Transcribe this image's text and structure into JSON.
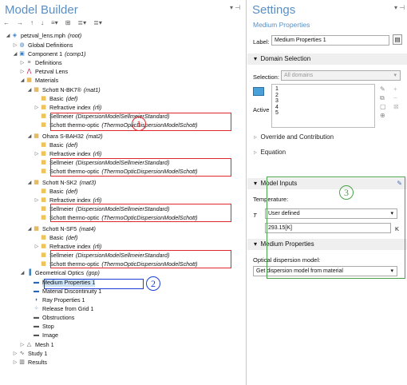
{
  "model_builder": {
    "title": "Model Builder",
    "toolbar_icons": [
      "back-arrow-icon",
      "forward-arrow-icon",
      "up-arrow-icon",
      "down-arrow-icon",
      "filter-icon",
      "tree-options-icon",
      "expand-icon",
      "collapse-icon"
    ],
    "tree": [
      {
        "label": "petzval_lens.mph",
        "tag": "(root)",
        "icon": "file-icon",
        "indent": 0,
        "expanded": true
      },
      {
        "label": "Global Definitions",
        "tag": "",
        "icon": "globe-icon",
        "indent": 1,
        "expanded": false
      },
      {
        "label": "Component 1",
        "tag": "(comp1)",
        "icon": "component-icon",
        "indent": 1,
        "expanded": true
      },
      {
        "label": "Definitions",
        "tag": "",
        "icon": "definitions-icon",
        "indent": 2,
        "expanded": false
      },
      {
        "label": "Petzval Lens",
        "tag": "",
        "icon": "geometry-icon",
        "indent": 2,
        "expanded": false
      },
      {
        "label": "Materials",
        "tag": "",
        "icon": "materials-icon",
        "indent": 2,
        "expanded": true
      },
      {
        "label": "Schott N-BK7®",
        "tag": "(mat1)",
        "icon": "material-icon",
        "indent": 3,
        "expanded": true
      },
      {
        "label": "Basic",
        "tag": "(def)",
        "icon": "property-icon",
        "indent": 4
      },
      {
        "label": "Refractive index",
        "tag": "(rfi)",
        "icon": "property-icon",
        "indent": 4,
        "expanded": false
      },
      {
        "label": "Sellmeier",
        "tag": "(DispersionModelSellmeierStandard)",
        "icon": "property-icon",
        "indent": 4
      },
      {
        "label": "Schott thermo-optic",
        "tag": "(ThermoOpticDispersionModelSchott)",
        "icon": "property-icon",
        "indent": 4
      },
      {
        "label": "Ohara S-BAH32",
        "tag": "(mat2)",
        "icon": "material-icon",
        "indent": 3,
        "expanded": true
      },
      {
        "label": "Basic",
        "tag": "(def)",
        "icon": "property-icon",
        "indent": 4
      },
      {
        "label": "Refractive index",
        "tag": "(rfi)",
        "icon": "property-icon",
        "indent": 4,
        "expanded": false
      },
      {
        "label": "Sellmeier",
        "tag": "(DispersionModelSellmeierStandard)",
        "icon": "property-icon",
        "indent": 4
      },
      {
        "label": "Schott thermo-optic",
        "tag": "(ThermoOpticDispersionModelSchott)",
        "icon": "property-icon",
        "indent": 4
      },
      {
        "label": "Schott N-SK2",
        "tag": "(mat3)",
        "icon": "material-icon",
        "indent": 3,
        "expanded": true
      },
      {
        "label": "Basic",
        "tag": "(def)",
        "icon": "property-icon",
        "indent": 4
      },
      {
        "label": "Refractive index",
        "tag": "(rfi)",
        "icon": "property-icon",
        "indent": 4,
        "expanded": false
      },
      {
        "label": "Sellmeier",
        "tag": "(DispersionModelSellmeierStandard)",
        "icon": "property-icon",
        "indent": 4
      },
      {
        "label": "Schott thermo-optic",
        "tag": "(ThermoOpticDispersionModelSchott)",
        "icon": "property-icon",
        "indent": 4
      },
      {
        "label": "Schott N-SF5",
        "tag": "(mat4)",
        "icon": "material-icon",
        "indent": 3,
        "expanded": true
      },
      {
        "label": "Basic",
        "tag": "(def)",
        "icon": "property-icon",
        "indent": 4
      },
      {
        "label": "Refractive index",
        "tag": "(rfi)",
        "icon": "property-icon",
        "indent": 4,
        "expanded": false
      },
      {
        "label": "Sellmeier",
        "tag": "(DispersionModelSellmeierStandard)",
        "icon": "property-icon",
        "indent": 4
      },
      {
        "label": "Schott thermo-optic",
        "tag": "(ThermoOpticDispersionModelSchott)",
        "icon": "property-icon",
        "indent": 4
      },
      {
        "label": "Geometrical Optics",
        "tag": "(gop)",
        "icon": "physics-icon",
        "indent": 2,
        "expanded": true
      },
      {
        "label": "Medium Properties 1",
        "tag": "",
        "icon": "medium-icon",
        "indent": 3,
        "selected": true
      },
      {
        "label": "Material Discontinuity 1",
        "tag": "",
        "icon": "medium-icon",
        "indent": 3
      },
      {
        "label": "Ray Properties 1",
        "tag": "",
        "icon": "ray-icon",
        "indent": 3
      },
      {
        "label": "Release from Grid 1",
        "tag": "",
        "icon": "grid-icon",
        "indent": 3
      },
      {
        "label": "Obstructions",
        "tag": "",
        "icon": "wall-icon",
        "indent": 3
      },
      {
        "label": "Stop",
        "tag": "",
        "icon": "wall-icon",
        "indent": 3
      },
      {
        "label": "Image",
        "tag": "",
        "icon": "wall-icon",
        "indent": 3
      },
      {
        "label": "Mesh 1",
        "tag": "",
        "icon": "mesh-icon",
        "indent": 2,
        "expanded": false
      },
      {
        "label": "Study 1",
        "tag": "",
        "icon": "study-icon",
        "indent": 1,
        "expanded": false
      },
      {
        "label": "Results",
        "tag": "",
        "icon": "results-icon",
        "indent": 1,
        "expanded": false
      }
    ],
    "callouts": [
      "1",
      "2",
      "3"
    ]
  },
  "settings": {
    "title": "Settings",
    "subtitle": "Medium Properties",
    "label_caption": "Label:",
    "label_value": "Medium Properties 1",
    "sections": {
      "domain_selection": "Domain Selection",
      "override": "Override and Contribution",
      "equation": "Equation",
      "model_inputs": "Model Inputs",
      "medium_properties": "Medium Properties"
    },
    "selection_caption": "Selection:",
    "selection_value": "All domains",
    "domains": [
      "1",
      "2",
      "3",
      "4",
      "5"
    ],
    "active_label": "Active",
    "temperature_caption": "Temperature:",
    "temperature_symbol": "T",
    "temperature_mode": "User defined",
    "temperature_value": "293.15[K]",
    "temperature_unit": "K",
    "dispersion_caption": "Optical dispersion model:",
    "dispersion_value": "Get dispersion model from material",
    "colors": {
      "title_blue": "#5b8fc4",
      "callout_red": "#e0272b",
      "callout_blue": "#1b3fd6",
      "callout_green": "#4aa34a"
    }
  }
}
